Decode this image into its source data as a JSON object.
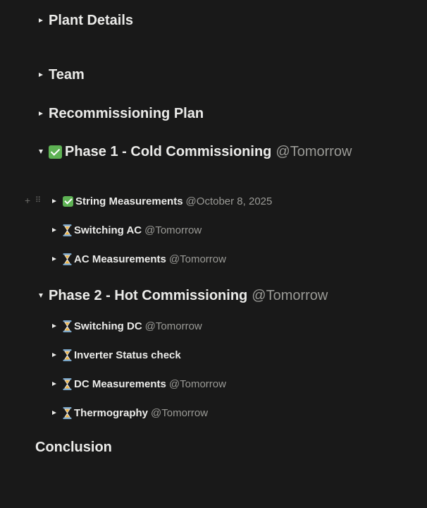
{
  "colors": {
    "background": "#191919",
    "text": "#ebebe9",
    "mention": "#9a9a96",
    "check_green": "#5eb254",
    "handle": "#6b6b68"
  },
  "sections": {
    "plant_details": {
      "title": "Plant Details",
      "state": "collapsed"
    },
    "team": {
      "title": "Team",
      "state": "collapsed"
    },
    "recommissioning_plan": {
      "title": "Recommissioning Plan",
      "state": "collapsed"
    },
    "phase1": {
      "icon": "check-mark-button-icon",
      "title": "Phase 1 - Cold Commissioning",
      "mention": "@Tomorrow",
      "state": "expanded",
      "items": [
        {
          "icon": "check-mark-button-icon",
          "label": "String Measurements",
          "mention": "@October 8, 2025"
        },
        {
          "icon": "hourglass-icon",
          "label": "Switching AC",
          "mention": "@Tomorrow"
        },
        {
          "icon": "hourglass-icon",
          "label": "AC Measurements",
          "mention": "@Tomorrow"
        }
      ]
    },
    "phase2": {
      "title": "Phase 2 - Hot Commissioning",
      "mention": "@Tomorrow",
      "state": "expanded",
      "items": [
        {
          "icon": "hourglass-icon",
          "label": "Switching DC",
          "mention": "@Tomorrow"
        },
        {
          "icon": "hourglass-icon",
          "label": "Inverter Status check"
        },
        {
          "icon": "hourglass-icon",
          "label": "DC Measurements",
          "mention": "@Tomorrow"
        },
        {
          "icon": "hourglass-icon",
          "label": "Thermography",
          "mention": "@Tomorrow"
        }
      ]
    },
    "conclusion": {
      "title": "Conclusion"
    }
  },
  "hover_controls": {
    "add_glyph": "+",
    "drag_glyph": "⠿",
    "add_icon": "plus-icon",
    "drag_icon": "drag-handle-icon"
  }
}
